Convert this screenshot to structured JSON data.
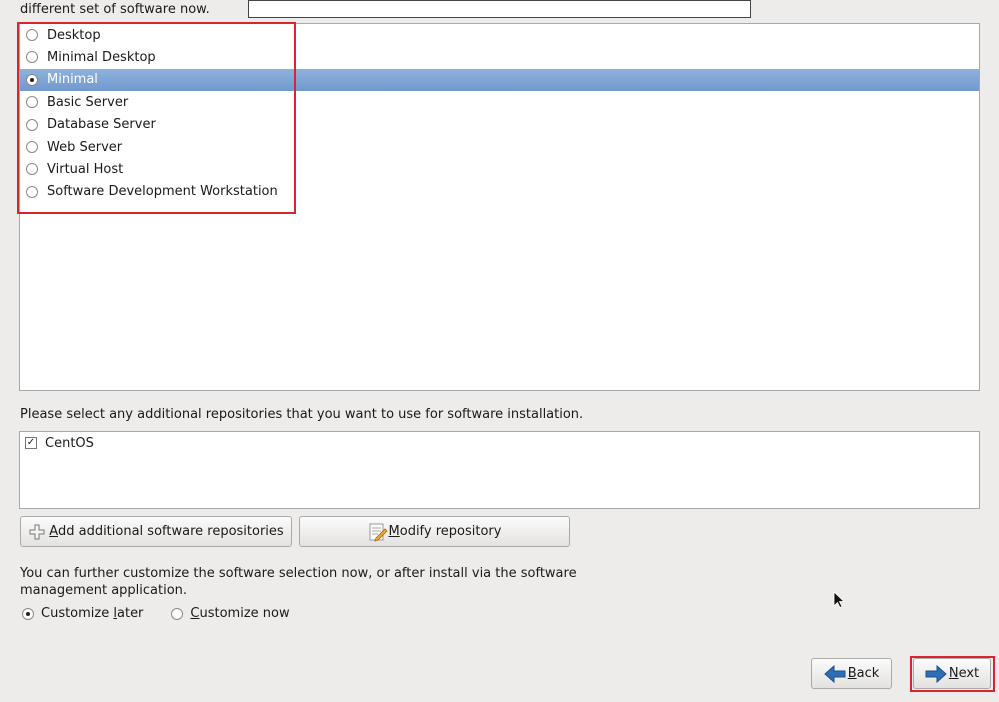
{
  "header": {
    "partial_text": "different set of software now."
  },
  "groups": [
    {
      "label": "Desktop",
      "selected": false
    },
    {
      "label": "Minimal Desktop",
      "selected": false
    },
    {
      "label": "Minimal",
      "selected": true
    },
    {
      "label": "Basic Server",
      "selected": false
    },
    {
      "label": "Database Server",
      "selected": false
    },
    {
      "label": "Web Server",
      "selected": false
    },
    {
      "label": "Virtual Host",
      "selected": false
    },
    {
      "label": "Software Development Workstation",
      "selected": false
    }
  ],
  "repos": {
    "label": "Please select any additional repositories that you want to use for software installation.",
    "items": [
      {
        "label": "CentOS",
        "checked": true
      }
    ]
  },
  "buttons": {
    "add": {
      "label": "Add additional software repositories",
      "mnemonic": 0,
      "icon": "plus-icon"
    },
    "modify": {
      "label": "Modify repository",
      "mnemonic": 0,
      "icon": "edit-document-icon"
    },
    "back": {
      "label": "Back",
      "mnemonic": 0,
      "icon": "arrow-left-icon"
    },
    "next": {
      "label": "Next",
      "mnemonic": 0,
      "icon": "arrow-right-icon"
    }
  },
  "customize": {
    "text": "You can further customize the software selection now, or after install via the software management application.",
    "options": [
      {
        "label": "Customize later",
        "mnemonic": 10,
        "selected": true
      },
      {
        "label": "Customize now",
        "mnemonic": 0,
        "selected": false
      }
    ]
  },
  "colors": {
    "selection": "#7fa6d6",
    "highlight_box": "#d9262c",
    "arrow": "#2f6db5"
  }
}
